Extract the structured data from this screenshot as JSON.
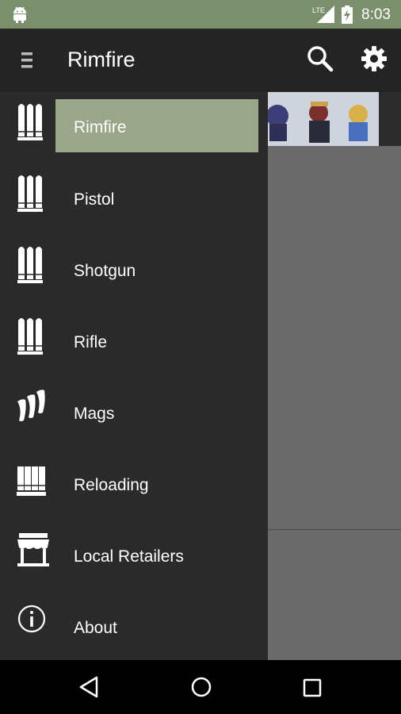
{
  "status_bar": {
    "network": "LTE",
    "time": "8:03",
    "icons": [
      "android-icon",
      "lte-signal-icon",
      "battery-charging-icon"
    ]
  },
  "toolbar": {
    "title": "Rimfire",
    "icons": [
      "menu-icon",
      "search-icon",
      "settings-gear-icon"
    ]
  },
  "drawer": {
    "items": [
      {
        "label": "Rimfire",
        "icon": "ammo-icon",
        "selected": true
      },
      {
        "label": "Pistol",
        "icon": "ammo-icon",
        "selected": false
      },
      {
        "label": "Shotgun",
        "icon": "ammo-icon",
        "selected": false
      },
      {
        "label": "Rifle",
        "icon": "ammo-icon",
        "selected": false
      },
      {
        "label": "Mags",
        "icon": "magazine-icon",
        "selected": false
      },
      {
        "label": "Reloading",
        "icon": "reloading-icon",
        "selected": false
      },
      {
        "label": "Local Retailers",
        "icon": "storefront-icon",
        "selected": false
      },
      {
        "label": "About",
        "icon": "info-icon",
        "selected": false
      }
    ]
  },
  "colors": {
    "status_bar": "#7c8f6c",
    "toolbar": "#242424",
    "drawer": "#2a2a2a",
    "selected_item": "#9aa68a",
    "content": "#6a6a6a",
    "nav_bar": "#000000"
  },
  "nav_bar": {
    "icons": [
      "back-icon",
      "home-icon",
      "recents-icon"
    ]
  }
}
